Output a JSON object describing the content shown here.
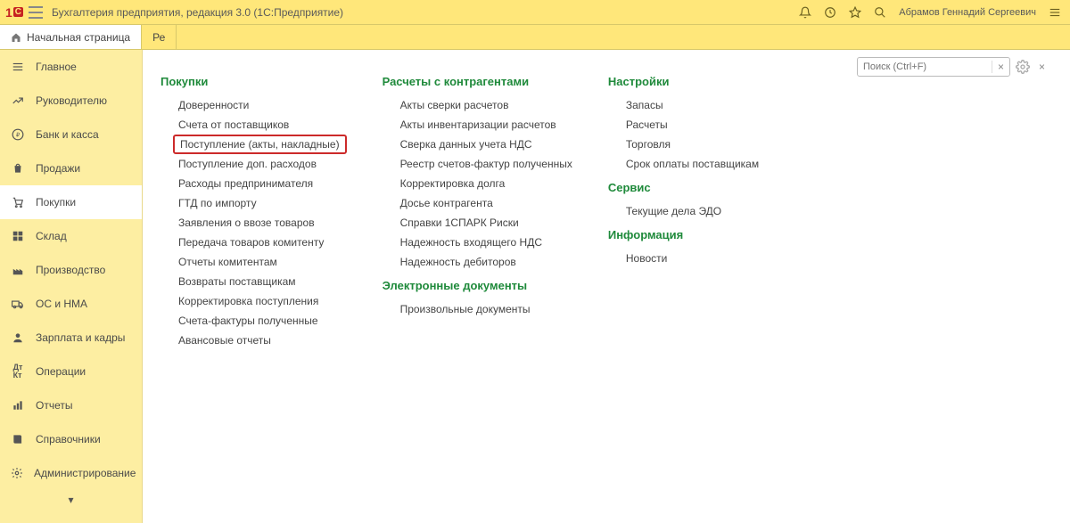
{
  "topbar": {
    "app_title": "Бухгалтерия предприятия, редакция 3.0   (1С:Предприятие)",
    "user": "Абрамов Геннадий Сергеевич"
  },
  "tabs": {
    "home": "Начальная страница",
    "second": "Ре"
  },
  "sidebar": [
    {
      "icon": "menu",
      "label": "Главное"
    },
    {
      "icon": "trend",
      "label": "Руководителю"
    },
    {
      "icon": "ruble",
      "label": "Банк и касса"
    },
    {
      "icon": "bag",
      "label": "Продажи"
    },
    {
      "icon": "cart",
      "label": "Покупки",
      "active": true
    },
    {
      "icon": "boxes",
      "label": "Склад"
    },
    {
      "icon": "factory",
      "label": "Производство"
    },
    {
      "icon": "truck",
      "label": "ОС и НМА"
    },
    {
      "icon": "person",
      "label": "Зарплата и кадры"
    },
    {
      "icon": "ops",
      "label": "Операции"
    },
    {
      "icon": "chart",
      "label": "Отчеты"
    },
    {
      "icon": "book",
      "label": "Справочники"
    },
    {
      "icon": "gear",
      "label": "Администрирование"
    }
  ],
  "main": {
    "col1": {
      "title": "Покупки",
      "items": [
        "Доверенности",
        "Счета от поставщиков",
        "Поступление (акты, накладные)",
        "Поступление доп. расходов",
        "Расходы предпринимателя",
        "ГТД по импорту",
        "Заявления о ввозе товаров",
        "Передача товаров комитенту",
        "Отчеты комитентам",
        "Возвраты поставщикам",
        "Корректировка поступления",
        "Счета-фактуры полученные",
        "Авансовые отчеты"
      ],
      "highlight_index": 2
    },
    "col2a": {
      "title": "Расчеты с контрагентами",
      "items": [
        "Акты сверки расчетов",
        "Акты инвентаризации расчетов",
        "Сверка данных учета НДС",
        "Реестр счетов-фактур полученных",
        "Корректировка долга",
        "Досье контрагента",
        "Справки 1СПАРК Риски",
        "Надежность входящего НДС",
        "Надежность дебиторов"
      ]
    },
    "col2b": {
      "title": "Электронные документы",
      "items": [
        "Произвольные документы"
      ]
    },
    "col3a": {
      "title": "Настройки",
      "items": [
        "Запасы",
        "Расчеты",
        "Торговля",
        "Срок оплаты поставщикам"
      ]
    },
    "col3b": {
      "title": "Сервис",
      "items": [
        "Текущие дела ЭДО"
      ]
    },
    "col3c": {
      "title": "Информация",
      "items": [
        "Новости"
      ]
    }
  },
  "search": {
    "placeholder": "Поиск (Ctrl+F)"
  }
}
